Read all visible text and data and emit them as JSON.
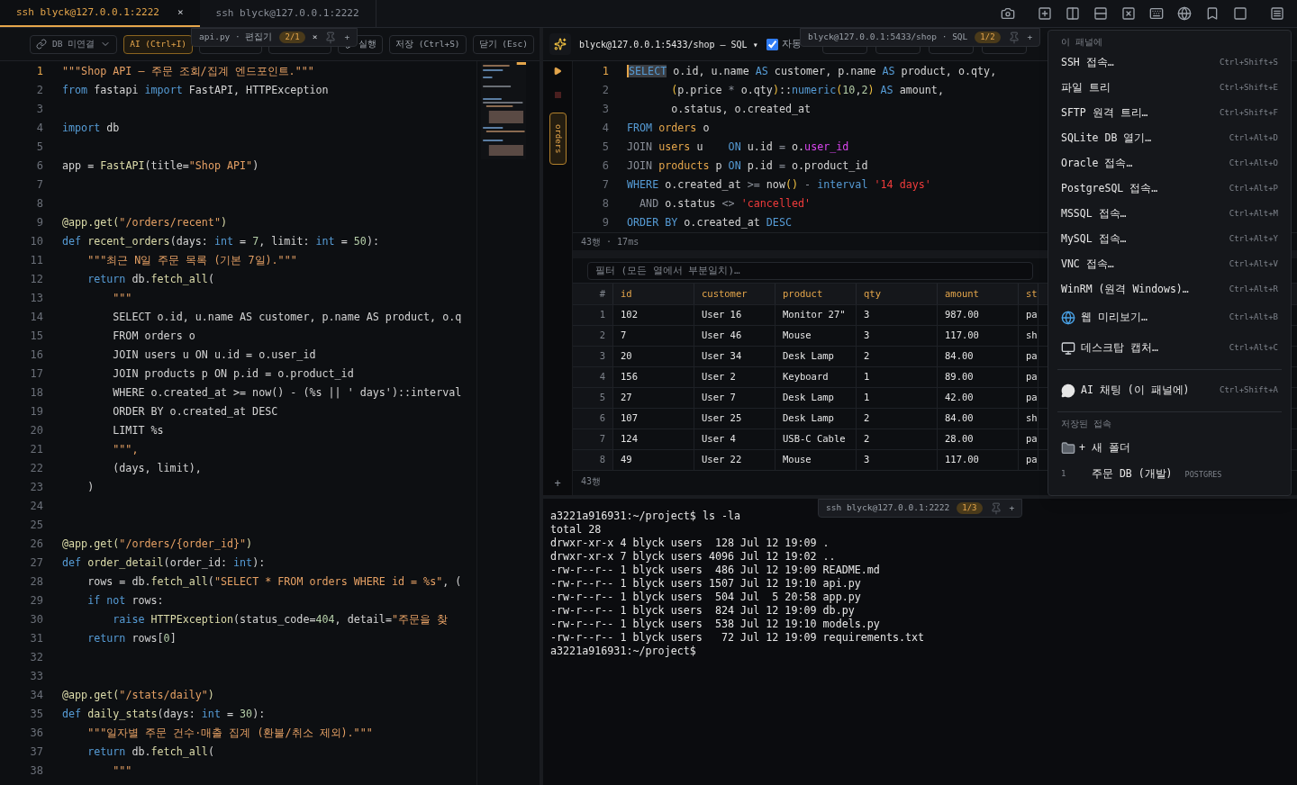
{
  "tabs": [
    {
      "label": "ssh blyck@127.0.0.1:2222",
      "selected": true,
      "close": "×"
    },
    {
      "label": "ssh blyck@127.0.0.1:2222",
      "selected": false
    }
  ],
  "editor": {
    "toolbar": {
      "db_status": "DB 미연결",
      "buttons": [
        {
          "label": "AI (Ctrl+I)",
          "kind": "accent"
        },
        {
          "kind": "covered"
        },
        {
          "kind": "covered"
        },
        {
          "label": "실행",
          "kind": "run"
        },
        {
          "label": "저장 (Ctrl+S)",
          "kind": "plain"
        },
        {
          "label": "닫기 (Esc)",
          "kind": "plain"
        }
      ]
    },
    "float_tab": {
      "title": "api.py · 편집기",
      "badge": "2/1",
      "close": "×",
      "add": "+"
    },
    "lines": [
      {
        "n": "1",
        "current": true,
        "tokens": [
          {
            "text": "\"\"\"Shop API — 주문 조회/집계 엔드포인트.\"\"\"",
            "kind": "str"
          }
        ]
      },
      {
        "n": "2",
        "current": false,
        "tokens": [
          {
            "text": "from",
            "kind": "kw"
          },
          {
            "text": " fastapi ",
            "kind": "p"
          },
          {
            "text": "import",
            "kind": "kw"
          },
          {
            "text": " FastAPI, HTTPException",
            "kind": "p"
          }
        ]
      },
      {
        "n": "3",
        "current": false
      },
      {
        "n": "4",
        "current": false,
        "tokens": [
          {
            "text": "import",
            "kind": "kw"
          },
          {
            "text": " db",
            "kind": "p"
          }
        ]
      },
      {
        "n": "5",
        "current": false
      },
      {
        "n": "6",
        "current": false,
        "tokens": [
          {
            "text": "app = ",
            "kind": "p"
          },
          {
            "text": "FastAPI",
            "kind": "fn"
          },
          {
            "text": "(title=",
            "kind": "p"
          },
          {
            "text": "\"Shop API\"",
            "kind": "str"
          },
          {
            "text": ")",
            "kind": "p"
          }
        ]
      },
      {
        "n": "7",
        "current": false
      },
      {
        "n": "8",
        "current": false
      },
      {
        "n": "9",
        "current": false,
        "tokens": [
          {
            "text": "@app.get(",
            "kind": "fn"
          },
          {
            "text": "\"/orders/recent\"",
            "kind": "str"
          },
          {
            "text": ")",
            "kind": "fn"
          }
        ]
      },
      {
        "n": "10",
        "current": false,
        "tokens": [
          {
            "text": "def ",
            "kind": "kw"
          },
          {
            "text": "recent_orders",
            "kind": "fn"
          },
          {
            "text": "(days: ",
            "kind": "p"
          },
          {
            "text": "int",
            "kind": "kw"
          },
          {
            "text": " = ",
            "kind": "p"
          },
          {
            "text": "7",
            "kind": "num"
          },
          {
            "text": ", limit: ",
            "kind": "p"
          },
          {
            "text": "int",
            "kind": "kw"
          },
          {
            "text": " = ",
            "kind": "p"
          },
          {
            "text": "50",
            "kind": "num"
          },
          {
            "text": "):",
            "kind": "p"
          }
        ]
      },
      {
        "n": "11",
        "current": false,
        "tokens": [
          {
            "text": "    \"\"\"최근 N일 주문 목록 (기본 7일).\"\"\"",
            "kind": "str"
          }
        ]
      },
      {
        "n": "12",
        "current": false,
        "tokens": [
          {
            "text": "    return",
            "kind": "kw"
          },
          {
            "text": " db.",
            "kind": "p"
          },
          {
            "text": "fetch_all",
            "kind": "fn"
          },
          {
            "text": "(",
            "kind": "p"
          }
        ]
      },
      {
        "n": "13",
        "current": false,
        "tokens": [
          {
            "text": "        \"\"\"",
            "kind": "str"
          }
        ]
      },
      {
        "n": "14",
        "current": false,
        "tokens": [
          {
            "text": "        SELECT o.id, u.name AS customer, p.name AS product, o.q",
            "kind": "p"
          }
        ]
      },
      {
        "n": "15",
        "current": false,
        "tokens": [
          {
            "text": "        FROM orders o",
            "kind": "p"
          }
        ]
      },
      {
        "n": "16",
        "current": false,
        "tokens": [
          {
            "text": "        JOIN users u ON u.id = o.user_id",
            "kind": "p"
          }
        ]
      },
      {
        "n": "17",
        "current": false,
        "tokens": [
          {
            "text": "        JOIN products p ON p.id = o.product_id",
            "kind": "p"
          }
        ]
      },
      {
        "n": "18",
        "current": false,
        "tokens": [
          {
            "text": "        WHERE o.created_at >= now() - (%s || ' days')::interval",
            "kind": "p"
          }
        ]
      },
      {
        "n": "19",
        "current": false,
        "tokens": [
          {
            "text": "        ORDER BY o.created_at DESC",
            "kind": "p"
          }
        ]
      },
      {
        "n": "20",
        "current": false,
        "tokens": [
          {
            "text": "        LIMIT %s",
            "kind": "p"
          }
        ]
      },
      {
        "n": "21",
        "current": false,
        "tokens": [
          {
            "text": "        \"\"\",",
            "kind": "str"
          }
        ]
      },
      {
        "n": "22",
        "current": false,
        "tokens": [
          {
            "text": "        (days, limit),",
            "kind": "p"
          }
        ]
      },
      {
        "n": "23",
        "current": false,
        "tokens": [
          {
            "text": "    )",
            "kind": "p"
          }
        ]
      },
      {
        "n": "24",
        "current": false
      },
      {
        "n": "25",
        "current": false
      },
      {
        "n": "26",
        "current": false,
        "tokens": [
          {
            "text": "@app.get(",
            "kind": "fn"
          },
          {
            "text": "\"/orders/{order_id}\"",
            "kind": "str"
          },
          {
            "text": ")",
            "kind": "fn"
          }
        ]
      },
      {
        "n": "27",
        "current": false,
        "tokens": [
          {
            "text": "def ",
            "kind": "kw"
          },
          {
            "text": "order_detail",
            "kind": "fn"
          },
          {
            "text": "(order_id: ",
            "kind": "p"
          },
          {
            "text": "int",
            "kind": "kw"
          },
          {
            "text": "):",
            "kind": "p"
          }
        ]
      },
      {
        "n": "28",
        "current": false,
        "tokens": [
          {
            "text": "    rows = db.",
            "kind": "p"
          },
          {
            "text": "fetch_all",
            "kind": "fn"
          },
          {
            "text": "(",
            "kind": "p"
          },
          {
            "text": "\"SELECT * FROM orders WHERE id = %s\"",
            "kind": "str"
          },
          {
            "text": ", (",
            "kind": "p"
          }
        ]
      },
      {
        "n": "29",
        "current": false,
        "tokens": [
          {
            "text": "    if not",
            "kind": "kw"
          },
          {
            "text": " rows:",
            "kind": "p"
          }
        ]
      },
      {
        "n": "30",
        "current": false,
        "tokens": [
          {
            "text": "        raise ",
            "kind": "kw"
          },
          {
            "text": "HTTPException",
            "kind": "fn"
          },
          {
            "text": "(status_code=",
            "kind": "p"
          },
          {
            "text": "404",
            "kind": "num"
          },
          {
            "text": ", detail=",
            "kind": "p"
          },
          {
            "text": "\"주문을 찾",
            "kind": "str"
          }
        ]
      },
      {
        "n": "31",
        "current": false,
        "tokens": [
          {
            "text": "    return",
            "kind": "kw"
          },
          {
            "text": " rows[",
            "kind": "p"
          },
          {
            "text": "0",
            "kind": "num"
          },
          {
            "text": "]",
            "kind": "p"
          }
        ]
      },
      {
        "n": "32",
        "current": false
      },
      {
        "n": "33",
        "current": false
      },
      {
        "n": "34",
        "current": false,
        "tokens": [
          {
            "text": "@app.get(",
            "kind": "fn"
          },
          {
            "text": "\"/stats/daily\"",
            "kind": "str"
          },
          {
            "text": ")",
            "kind": "fn"
          }
        ]
      },
      {
        "n": "35",
        "current": false,
        "tokens": [
          {
            "text": "def ",
            "kind": "kw"
          },
          {
            "text": "daily_stats",
            "kind": "fn"
          },
          {
            "text": "(days: ",
            "kind": "p"
          },
          {
            "text": "int",
            "kind": "kw"
          },
          {
            "text": " = ",
            "kind": "p"
          },
          {
            "text": "30",
            "kind": "num"
          },
          {
            "text": "):",
            "kind": "p"
          }
        ]
      },
      {
        "n": "36",
        "current": false,
        "tokens": [
          {
            "text": "    \"\"\"일자별 주문 건수·매출 집계 (환불/취소 제외).\"\"\"",
            "kind": "str"
          }
        ]
      },
      {
        "n": "37",
        "current": false,
        "tokens": [
          {
            "text": "    return",
            "kind": "kw"
          },
          {
            "text": " db.",
            "kind": "p"
          },
          {
            "text": "fetch_all",
            "kind": "fn"
          },
          {
            "text": "(",
            "kind": "p"
          }
        ]
      },
      {
        "n": "38",
        "current": false,
        "tokens": [
          {
            "text": "        \"\"\"",
            "kind": "str"
          }
        ]
      }
    ]
  },
  "sql": {
    "connection": "blyck@127.0.0.1:5433/shop — SQL ▾",
    "autocommit": {
      "label": "자동",
      "checked": true
    },
    "buttons": [
      {
        "kind": "covered_small"
      },
      {
        "kind": "covered_small"
      },
      {
        "kind": "covered_small"
      },
      {
        "kind": "covered_small"
      }
    ],
    "float_tab": {
      "title": "blyck@127.0.0.1:5433/shop · SQL",
      "badge": "1/2",
      "add": "+"
    },
    "object_tab": "orders",
    "lines": [
      {
        "n": "1",
        "current": true,
        "tokens": [
          {
            "text": "SELECT",
            "kind": "sel"
          },
          {
            "text": " o.id, u.name ",
            "kind": "p"
          },
          {
            "text": "AS",
            "kind": "kw"
          },
          {
            "text": " customer, p.name ",
            "kind": "p"
          },
          {
            "text": "AS",
            "kind": "kw"
          },
          {
            "text": " product, o.qty,",
            "kind": "p"
          }
        ]
      },
      {
        "n": "2",
        "current": false,
        "tokens": [
          {
            "text": "       (",
            "kind": "par"
          },
          {
            "text": "p.price ",
            "kind": "p"
          },
          {
            "text": "*",
            "kind": "dim"
          },
          {
            "text": " o.qty",
            "kind": "p"
          },
          {
            "text": ")",
            "kind": "par"
          },
          {
            "text": "::",
            "kind": "p"
          },
          {
            "text": "numeric",
            "kind": "kw"
          },
          {
            "text": "(",
            "kind": "par"
          },
          {
            "text": "10",
            "kind": "num"
          },
          {
            "text": ",",
            "kind": "p"
          },
          {
            "text": "2",
            "kind": "num"
          },
          {
            "text": ") ",
            "kind": "par"
          },
          {
            "text": "AS",
            "kind": "kw"
          },
          {
            "text": " amount,",
            "kind": "p"
          }
        ]
      },
      {
        "n": "3",
        "current": false,
        "tokens": [
          {
            "text": "       o.status, o.created_at",
            "kind": "p"
          }
        ]
      },
      {
        "n": "4",
        "current": false,
        "tokens": [
          {
            "text": "FROM ",
            "kind": "kw"
          },
          {
            "text": "orders",
            "kind": "tbl"
          },
          {
            "text": " o",
            "kind": "p"
          }
        ]
      },
      {
        "n": "5",
        "current": false,
        "tokens": [
          {
            "text": "JOIN ",
            "kind": "dim"
          },
          {
            "text": "users",
            "kind": "tbl"
          },
          {
            "text": " u    ",
            "kind": "p"
          },
          {
            "text": "ON",
            "kind": "kw"
          },
          {
            "text": " u.id ",
            "kind": "p"
          },
          {
            "text": "=",
            "kind": "dim"
          },
          {
            "text": " o.",
            "kind": "p"
          },
          {
            "text": "user_id",
            "kind": "mag"
          }
        ]
      },
      {
        "n": "6",
        "current": false,
        "tokens": [
          {
            "text": "JOIN ",
            "kind": "dim"
          },
          {
            "text": "products",
            "kind": "tbl"
          },
          {
            "text": " p ",
            "kind": "p"
          },
          {
            "text": "ON",
            "kind": "kw"
          },
          {
            "text": " p.id ",
            "kind": "p"
          },
          {
            "text": "=",
            "kind": "dim"
          },
          {
            "text": " o.product_id",
            "kind": "p"
          }
        ]
      },
      {
        "n": "7",
        "current": false,
        "tokens": [
          {
            "text": "WHERE",
            "kind": "kw"
          },
          {
            "text": " o.created_at ",
            "kind": "p"
          },
          {
            "text": ">=",
            "kind": "dim"
          },
          {
            "text": " now",
            "kind": "p"
          },
          {
            "text": "() ",
            "kind": "par"
          },
          {
            "text": "- ",
            "kind": "dim"
          },
          {
            "text": "interval ",
            "kind": "kw"
          },
          {
            "text": "'14 days'",
            "kind": "red"
          }
        ]
      },
      {
        "n": "8",
        "current": false,
        "tokens": [
          {
            "text": "  AND",
            "kind": "dim"
          },
          {
            "text": " o.status ",
            "kind": "p"
          },
          {
            "text": "<> ",
            "kind": "dim"
          },
          {
            "text": "'cancelled'",
            "kind": "red"
          }
        ]
      },
      {
        "n": "9",
        "current": false,
        "tokens": [
          {
            "text": "ORDER BY",
            "kind": "kw"
          },
          {
            "text": " o.created_at ",
            "kind": "p"
          },
          {
            "text": "DESC",
            "kind": "kw"
          }
        ]
      }
    ],
    "status": "43행 · 17ms"
  },
  "results": {
    "filter_placeholder": "필터 (모든 열에서 부분일치)…",
    "columns": [
      "#",
      "id",
      "customer",
      "product",
      "qty",
      "amount",
      "st"
    ],
    "rows": [
      [
        "1",
        "102",
        "User 16",
        "Monitor 27\"",
        "3",
        "987.00",
        "pa"
      ],
      [
        "2",
        "7",
        "User 46",
        "Mouse",
        "3",
        "117.00",
        "sh"
      ],
      [
        "3",
        "20",
        "User 34",
        "Desk Lamp",
        "2",
        "84.00",
        "pa"
      ],
      [
        "4",
        "156",
        "User 2",
        "Keyboard",
        "1",
        "89.00",
        "pa"
      ],
      [
        "5",
        "27",
        "User 7",
        "Desk Lamp",
        "1",
        "42.00",
        "pa"
      ],
      [
        "6",
        "107",
        "User 25",
        "Desk Lamp",
        "2",
        "84.00",
        "sh"
      ],
      [
        "7",
        "124",
        "User 4",
        "USB-C Cable",
        "2",
        "28.00",
        "pa"
      ],
      [
        "8",
        "49",
        "User 22",
        "Mouse",
        "3",
        "117.00",
        "pa"
      ]
    ],
    "add": "+",
    "count": "43행"
  },
  "terminal": {
    "lines": [
      "a3221a916931:~/project$ ls -la",
      "total 28",
      "drwxr-xr-x 4 blyck users  128 Jul 12 19:09 .",
      "drwxr-xr-x 7 blyck users 4096 Jul 12 19:02 ..",
      "-rw-r--r-- 1 blyck users  486 Jul 12 19:09 README.md",
      "-rw-r--r-- 1 blyck users 1507 Jul 12 19:10 api.py",
      "-rw-r--r-- 1 blyck users  504 Jul  5 20:58 app.py",
      "-rw-r--r-- 1 blyck users  824 Jul 12 19:09 db.py",
      "-rw-r--r-- 1 blyck users  538 Jul 12 19:10 models.py",
      "-rw-r--r-- 1 blyck users   72 Jul 12 19:09 requirements.txt",
      "a3221a916931:~/project$"
    ],
    "float_tab": {
      "title": "ssh blyck@127.0.0.1:2222",
      "badge": "1/3",
      "add": "+"
    }
  },
  "menu": {
    "heading": "이 패널에",
    "items": [
      {
        "label": "SSH 접속…",
        "shortcut": "Ctrl+Shift+S"
      },
      {
        "label": "파일 트리",
        "shortcut": "Ctrl+Shift+E"
      },
      {
        "label": "SFTP 원격 트리…",
        "shortcut": "Ctrl+Shift+F"
      },
      {
        "label": "SQLite DB 열기…",
        "shortcut": "Ctrl+Alt+D"
      },
      {
        "label": "Oracle 접속…",
        "shortcut": "Ctrl+Alt+O"
      },
      {
        "label": "PostgreSQL 접속…",
        "shortcut": "Ctrl+Alt+P"
      },
      {
        "label": "MSSQL 접속…",
        "shortcut": "Ctrl+Alt+M"
      },
      {
        "label": "MySQL 접속…",
        "shortcut": "Ctrl+Alt+Y"
      },
      {
        "label": "VNC 접속…",
        "shortcut": "Ctrl+Alt+V"
      },
      {
        "label": "WinRM (원격 Windows)…",
        "shortcut": "Ctrl+Alt+R"
      },
      {
        "label": "웹 미리보기…",
        "shortcut": "Ctrl+Alt+B",
        "kind": "web"
      },
      {
        "label": "데스크탑 캡처…",
        "shortcut": "Ctrl+Alt+C",
        "kind": "capture"
      }
    ],
    "extra_items": [
      {
        "label": "AI 채팅 (이 패널에)",
        "shortcut": "Ctrl+Shift+A",
        "kind": "chat"
      }
    ],
    "saved_heading": "저장된 접속",
    "new_folder": "+ 새 폴더",
    "saved": [
      {
        "index": "1",
        "name": "주문 DB (개발)",
        "type": "POSTGRES"
      }
    ]
  }
}
